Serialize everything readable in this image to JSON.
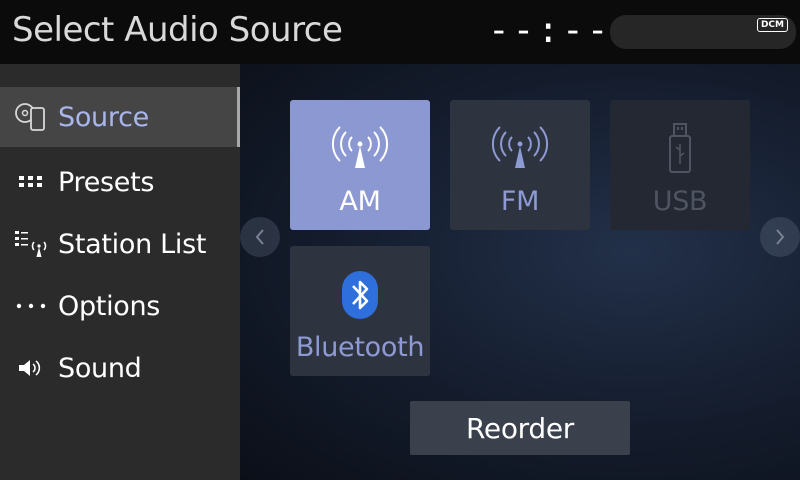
{
  "header": {
    "title": "Select Audio Source",
    "clock": "--:--",
    "badge": "DCM"
  },
  "sidebar": {
    "items": [
      {
        "label": "Source",
        "icon": "disc-phone-icon",
        "active": true
      },
      {
        "label": "Presets",
        "icon": "presets-grid-icon",
        "active": false
      },
      {
        "label": "Station List",
        "icon": "station-list-icon",
        "active": false
      },
      {
        "label": "Options",
        "icon": "more-dots-icon",
        "active": false
      },
      {
        "label": "Sound",
        "icon": "speaker-icon",
        "active": false
      }
    ]
  },
  "sources": [
    {
      "label": "AM",
      "icon": "antenna-icon",
      "state": "selected"
    },
    {
      "label": "FM",
      "icon": "antenna-icon",
      "state": "normal"
    },
    {
      "label": "USB",
      "icon": "usb-icon",
      "state": "disabled"
    },
    {
      "label": "Bluetooth",
      "icon": "bluetooth-icon",
      "state": "normal"
    }
  ],
  "reorder_label": "Reorder",
  "colors": {
    "accent": "#8b98d1",
    "accent_text": "#a9b6ec",
    "sidebar_bg": "#2b2b2b",
    "tile_bg": "#2e3340",
    "bluetooth_blue": "#2f6fdb"
  }
}
